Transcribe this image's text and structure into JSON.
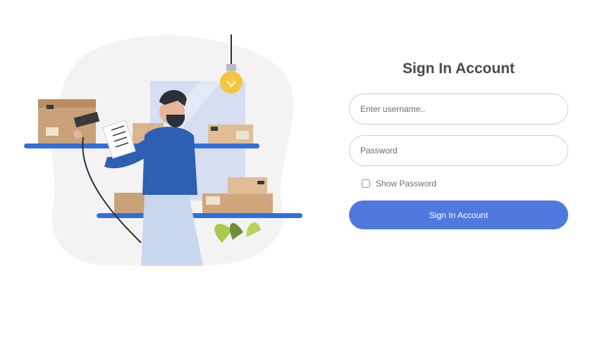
{
  "login": {
    "title": "Sign In Account",
    "username_placeholder": "Enter username..",
    "password_placeholder": "Password",
    "show_password_label": "Show Password",
    "submit_label": "Sign In Account"
  },
  "colors": {
    "accent": "#4f79de",
    "shelf": "#2f6fe0",
    "shirt": "#2d5fb3",
    "box": "#c9a27a",
    "bulb": "#f5c542"
  },
  "illustration": {
    "icon": "warehouse-worker-illustration"
  }
}
